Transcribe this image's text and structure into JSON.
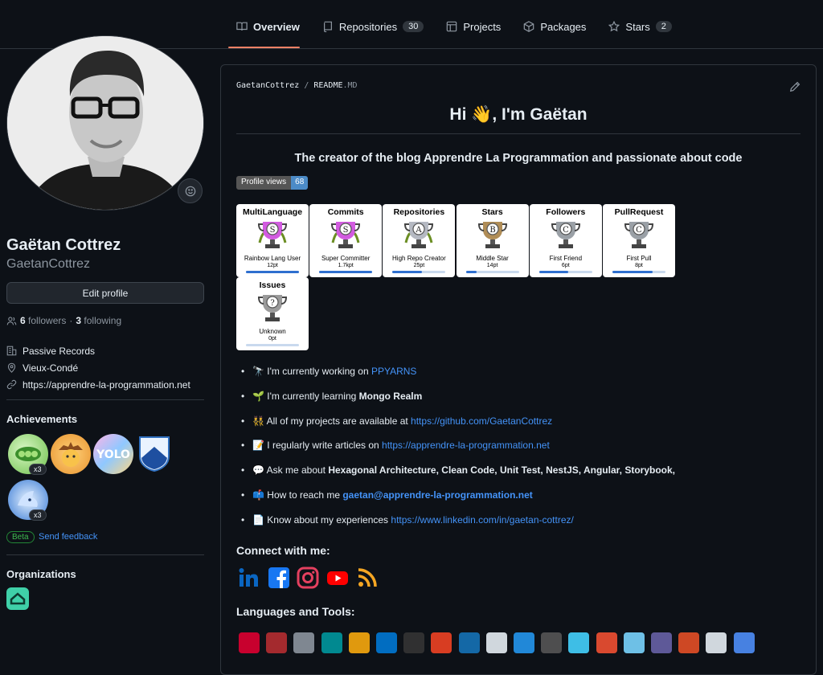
{
  "tabs": [
    {
      "label": "Overview",
      "icon": "book-icon",
      "active": true
    },
    {
      "label": "Repositories",
      "icon": "repo-icon",
      "count": "30"
    },
    {
      "label": "Projects",
      "icon": "table-icon"
    },
    {
      "label": "Packages",
      "icon": "package-icon"
    },
    {
      "label": "Stars",
      "icon": "star-icon",
      "count": "2"
    }
  ],
  "profile": {
    "name": "Gaëtan Cottrez",
    "login": "GaetanCottrez",
    "edit_label": "Edit profile",
    "followers_count": "6",
    "followers_label": "followers",
    "separator": "·",
    "following_count": "3",
    "following_label": "following",
    "company": "Passive Records",
    "location": "Vieux-Condé",
    "website": "https://apprendre-la-programmation.net"
  },
  "achievements": {
    "title": "Achievements",
    "badge_counts": [
      "x3",
      "x3"
    ],
    "beta_label": "Beta",
    "feedback_label": "Send feedback"
  },
  "organizations": {
    "title": "Organizations"
  },
  "readme": {
    "crumb_user": "GaetanCottrez",
    "crumb_sep": "/",
    "crumb_file": "README",
    "crumb_ext": ".MD",
    "heading": "Hi 👋, I'm Gaëtan",
    "subheading": "The creator of the blog Apprendre La Programmation and passionate about code",
    "views_label": "Profile views",
    "views_count": "68",
    "trophies": [
      {
        "title": "MultiLanguage",
        "rank": "S",
        "name": "Rainbow Lang User",
        "points": "12pt",
        "progress": 1.0
      },
      {
        "title": "Commits",
        "rank": "S",
        "name": "Super Committer",
        "points": "1.7kpt",
        "progress": 1.0
      },
      {
        "title": "Repositories",
        "rank": "A",
        "name": "High Repo Creator",
        "points": "25pt",
        "progress": 0.55
      },
      {
        "title": "Stars",
        "rank": "B",
        "name": "Middle Star",
        "points": "14pt",
        "progress": 0.2
      },
      {
        "title": "Followers",
        "rank": "C",
        "name": "First Friend",
        "points": "6pt",
        "progress": 0.55
      },
      {
        "title": "PullRequest",
        "rank": "C",
        "name": "First Pull",
        "points": "8pt",
        "progress": 0.75
      },
      {
        "title": "Issues",
        "rank": "?",
        "name": "Unknown",
        "points": "0pt",
        "progress": 0.0
      }
    ],
    "bullets": [
      {
        "emoji": "🔭",
        "text": "I'm currently working on ",
        "link": "PPYARNS"
      },
      {
        "emoji": "🌱",
        "text": "I'm currently learning ",
        "bold": "Mongo Realm"
      },
      {
        "emoji": "👯",
        "text": "All of my projects are available at ",
        "link": "https://github.com/GaetanCottrez"
      },
      {
        "emoji": "📝",
        "text": "I regularly write articles on ",
        "link": "https://apprendre-la-programmation.net"
      },
      {
        "emoji": "💬",
        "text": "Ask me about ",
        "bold": "Hexagonal Architecture, Clean Code, Unit Test, NestJS, Angular, Storybook,"
      },
      {
        "emoji": "📫",
        "text": "How to reach me ",
        "boldlink": "gaetan@apprendre-la-programmation.net"
      },
      {
        "emoji": "📄",
        "text": "Know about my experiences ",
        "link": "https://www.linkedin.com/in/gaetan-cottrez/"
      }
    ],
    "connect_heading": "Connect with me:",
    "social": [
      "linkedin-icon",
      "facebook-icon",
      "instagram-icon",
      "youtube-icon",
      "rss-icon"
    ],
    "tools_heading": "Languages and Tools:",
    "tools": [
      {
        "name": "angular-icon",
        "color": "#dd0031"
      },
      {
        "name": "angular-material-icon",
        "color": "#b52e31"
      },
      {
        "name": "github-actions-icon",
        "color": "#8c959f"
      },
      {
        "name": "arduino-icon",
        "color": "#00979d"
      },
      {
        "name": "aws-icon",
        "color": "#f7a80d"
      },
      {
        "name": "azure-icon",
        "color": "#0078d4"
      },
      {
        "name": "circleci-icon",
        "color": "#343434"
      },
      {
        "name": "codeigniter-icon",
        "color": "#ee4323"
      },
      {
        "name": "css3-icon",
        "color": "#1572b6"
      },
      {
        "name": "cypress-icon",
        "color": "#e6edf3"
      },
      {
        "name": "docker-icon",
        "color": "#2496ed"
      },
      {
        "name": "express-icon",
        "color": "#555555"
      },
      {
        "name": "flutter-icon",
        "color": "#44d1fd"
      },
      {
        "name": "git-icon",
        "color": "#f05032"
      },
      {
        "name": "go-icon",
        "color": "#79d4fd"
      },
      {
        "name": "heroku-icon",
        "color": "#6762a6"
      },
      {
        "name": "html5-icon",
        "color": "#e34f26"
      },
      {
        "name": "ifttt-icon",
        "color": "#e6edf3"
      },
      {
        "name": "ionic-icon",
        "color": "#4e8ef7"
      }
    ]
  }
}
